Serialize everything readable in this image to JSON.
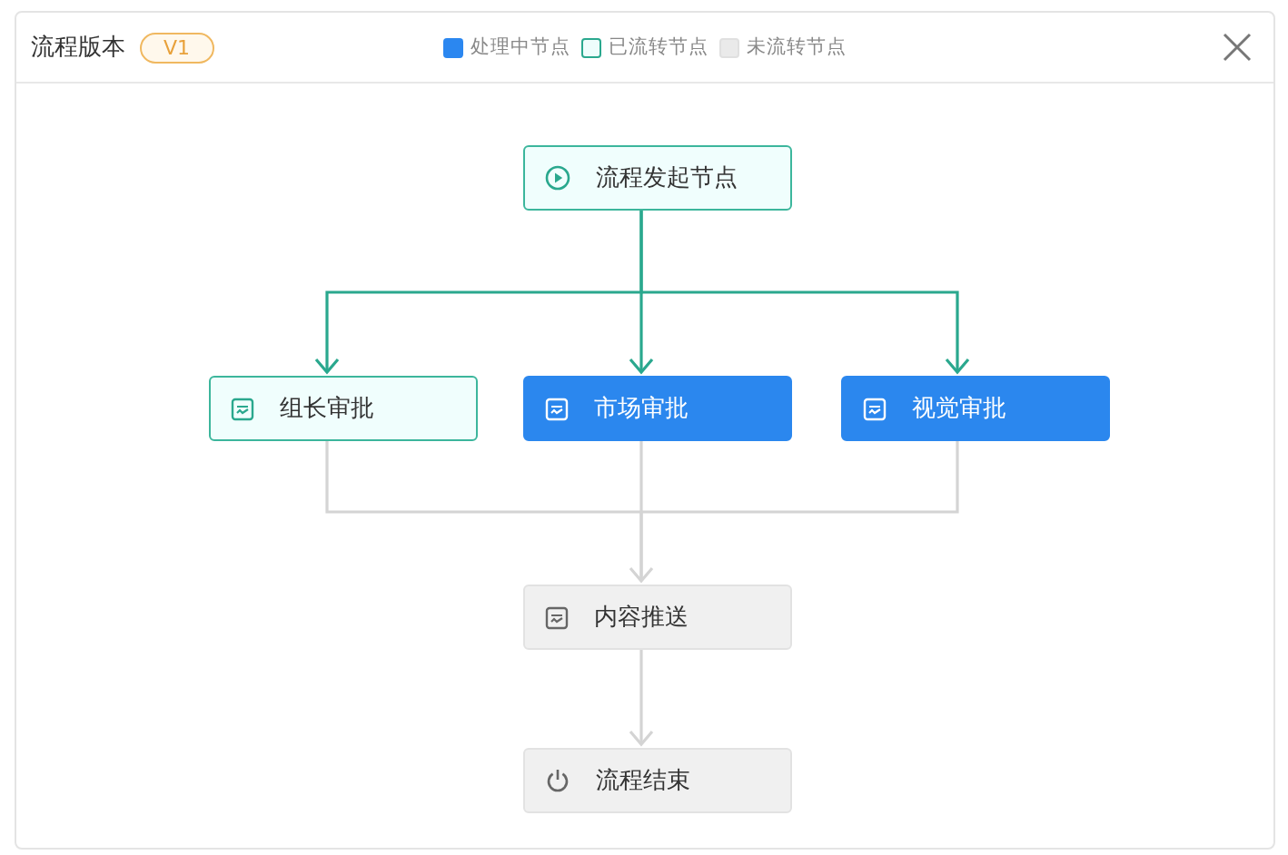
{
  "window": {
    "title": "流程版本",
    "version_badge": "V1"
  },
  "legend": [
    {
      "label": "处理中节点",
      "processing": true,
      "passed": false
    },
    {
      "label": "已流转节点",
      "processing": false,
      "passed": true
    },
    {
      "label": "未流转节点",
      "processing": false,
      "passed": false
    }
  ],
  "nodes": [
    {
      "label": "流程发起节点",
      "kind": "start",
      "processing": false,
      "passed": true
    },
    {
      "label": "组长审批",
      "kind": "approval",
      "processing": false,
      "passed": true
    },
    {
      "label": "市场审批",
      "kind": "approval",
      "processing": true,
      "passed": false
    },
    {
      "label": "视觉审批",
      "kind": "approval",
      "processing": true,
      "passed": false
    },
    {
      "label": "内容推送",
      "kind": "approval",
      "processing": false,
      "passed": false
    },
    {
      "label": "流程结束",
      "kind": "end",
      "processing": false,
      "passed": false
    }
  ]
}
